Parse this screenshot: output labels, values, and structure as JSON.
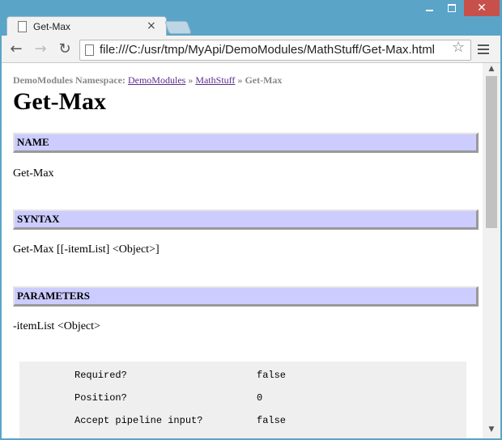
{
  "browser": {
    "tab_title": "Get-Max",
    "address": "file:///C:/usr/tmp/MyApi/DemoModules/MathStuff/Get-Max.html"
  },
  "page": {
    "breadcrumb": {
      "prefix": "DemoModules Namespace:",
      "link1": "DemoModules",
      "sep1": "»",
      "link2": "MathStuff",
      "sep2": "»",
      "current": "Get-Max"
    },
    "title": "Get-Max",
    "sections": {
      "name": {
        "header": "NAME",
        "body": "Get-Max"
      },
      "syntax": {
        "header": "SYNTAX",
        "body": "Get-Max [[-itemList] <Object>]"
      },
      "parameters": {
        "header": "PARAMETERS",
        "body": "-itemList <Object>"
      }
    },
    "parameter_details": [
      {
        "label": "Required?",
        "value": "false"
      },
      {
        "label": "Position?",
        "value": "0"
      },
      {
        "label": "Accept pipeline input?",
        "value": "false"
      }
    ]
  }
}
